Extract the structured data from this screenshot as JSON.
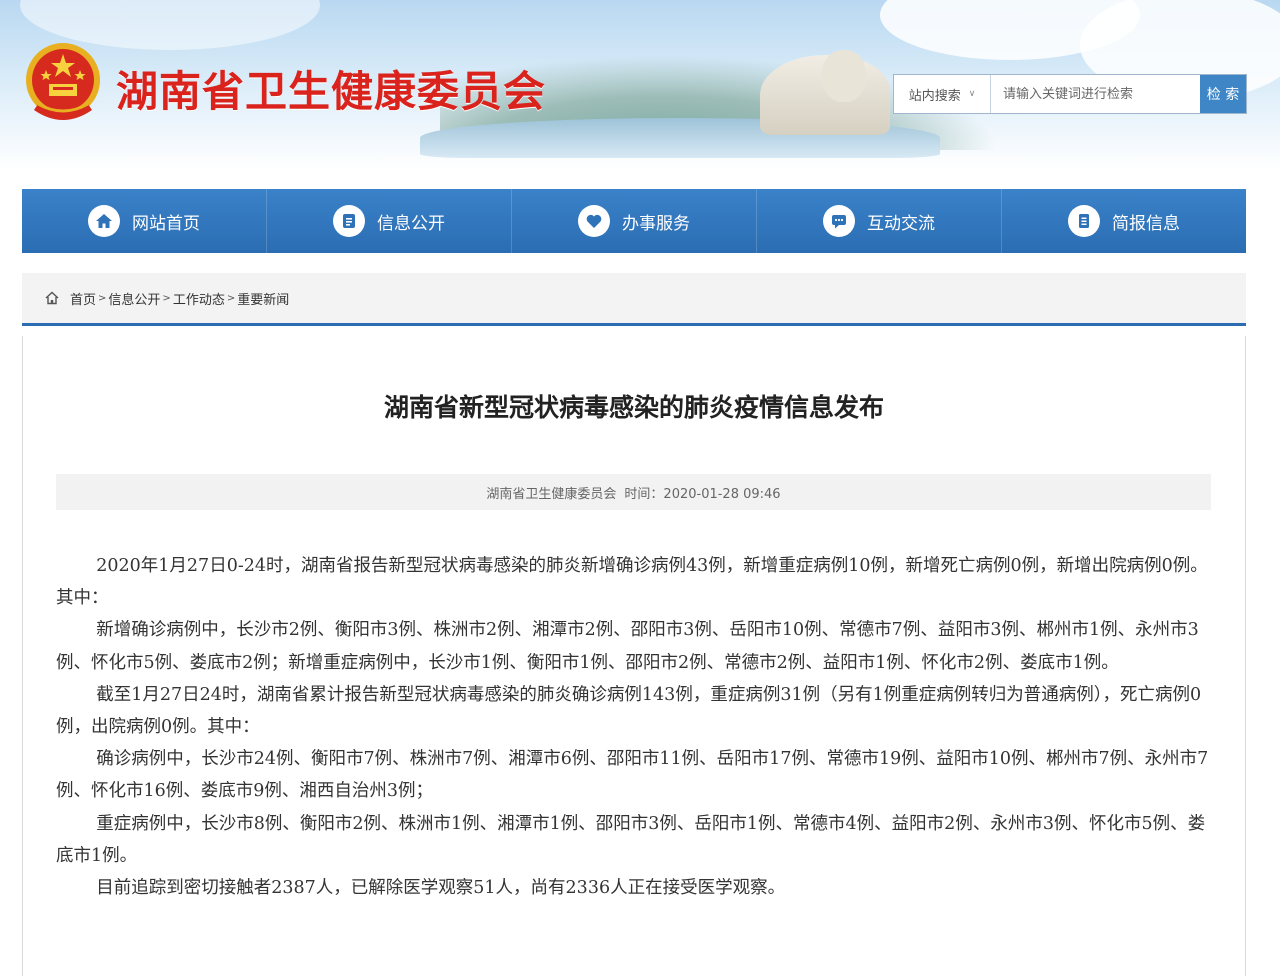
{
  "header": {
    "site_title": "湖南省卫生健康委员会",
    "search": {
      "scope": "站内搜索",
      "placeholder": "请输入关键词进行检索",
      "button": "检 索"
    }
  },
  "nav": {
    "items": [
      {
        "label": "网站首页",
        "icon": "home-icon"
      },
      {
        "label": "信息公开",
        "icon": "document-icon"
      },
      {
        "label": "办事服务",
        "icon": "heart-icon"
      },
      {
        "label": "互动交流",
        "icon": "chat-icon"
      },
      {
        "label": "简报信息",
        "icon": "report-icon"
      }
    ]
  },
  "breadcrumb": [
    "首页",
    "信息公开",
    "工作动态",
    "重要新闻"
  ],
  "article": {
    "title": "湖南省新型冠状病毒感染的肺炎疫情信息发布",
    "source": "湖南省卫生健康委员会",
    "time": "时间：2020-01-28 09:46",
    "paragraphs": [
      "2020年1月27日0-24时，湖南省报告新型冠状病毒感染的肺炎新增确诊病例43例，新增重症病例10例，新增死亡病例0例，新增出院病例0例。其中：",
      "新增确诊病例中，长沙市2例、衡阳市3例、株洲市2例、湘潭市2例、邵阳市3例、岳阳市10例、常德市7例、益阳市3例、郴州市1例、永州市3例、怀化市5例、娄底市2例；新增重症病例中，长沙市1例、衡阳市1例、邵阳市2例、常德市2例、益阳市1例、怀化市2例、娄底市1例。",
      "截至1月27日24时，湖南省累计报告新型冠状病毒感染的肺炎确诊病例143例，重症病例31例（另有1例重症病例转归为普通病例），死亡病例0例，出院病例0例。其中：",
      "确诊病例中，长沙市24例、衡阳市7例、株洲市7例、湘潭市6例、邵阳市11例、岳阳市17例、常德市19例、益阳市10例、郴州市7例、永州市7例、怀化市16例、娄底市9例、湘西自治州3例；",
      "重症病例中，长沙市8例、衡阳市2例、株洲市1例、湘潭市1例、邵阳市3例、岳阳市1例、常德市4例、益阳市2例、永州市3例、怀化市5例、娄底市1例。",
      "目前追踪到密切接触者2387人，已解除医学观察51人，尚有2336人正在接受医学观察。"
    ]
  },
  "colors": {
    "title_red": "#d9231c",
    "nav_blue": "#2b6db3",
    "search_btn": "#3e86c6"
  }
}
